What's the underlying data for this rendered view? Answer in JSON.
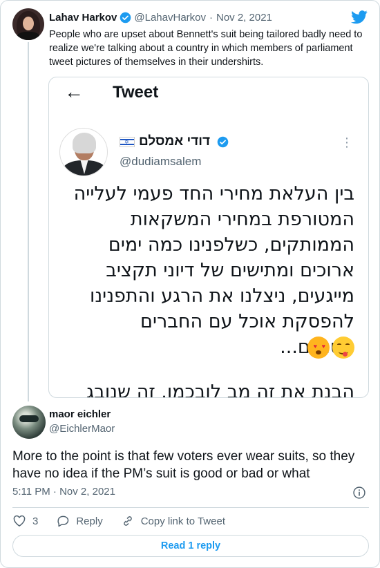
{
  "parent": {
    "name": "Lahav Harkov",
    "handle": "@LahavHarkov",
    "separator": "·",
    "date": "Nov 2, 2021",
    "text": "People who are upset about Bennett's suit being tailored badly need to realize we're talking about a country in which members of parliament tweet pictures of themselves in their undershirts."
  },
  "embed": {
    "back_icon": "←",
    "header_title": "Tweet",
    "name": "דודי אמסלם",
    "handle": "@dudiamsalem",
    "more_icon": "⋮",
    "body": "בין העלאת מחירי החד פעמי לעלייה המטורפת במחירי המשקאות הממותקים, כשלפנינו כמה ימים ארוכים ומתישים של דיוני תקציב מייגעים, ניצלנו את הרגע והתפנינו להפסקת אוכל עם החברים הטובים...",
    "cut_text": "הבנת את זה מב לובכמו. זה שנובג"
  },
  "reply": {
    "name": "maor eichler",
    "handle": "@EichlerMaor",
    "text": "More to the point is that few voters ever wear suits, so they have no idea if the PM’s suit is good or bad or what",
    "timestamp": "5:11 PM · Nov 2, 2021",
    "likes": "3",
    "reply_label": "Reply",
    "copy_label": "Copy link to Tweet",
    "read_label": "Read 1 reply"
  },
  "colors": {
    "accent": "#1d9bf0",
    "text": "#0f1419",
    "muted": "#536471",
    "border": "#cfd9de"
  }
}
